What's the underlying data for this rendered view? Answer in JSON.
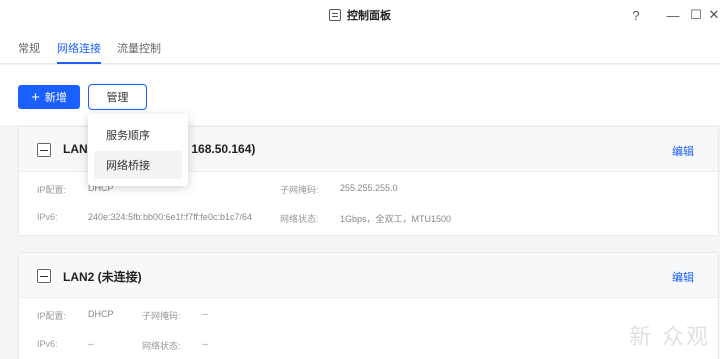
{
  "window": {
    "title": "控制面板",
    "help": "?",
    "minimize": "—",
    "maximize": "☐",
    "close": "✕"
  },
  "tabs": [
    {
      "label": "常规"
    },
    {
      "label": "网络连接"
    },
    {
      "label": "流量控制"
    }
  ],
  "toolbar": {
    "new_label": "新增",
    "manage_label": "管理"
  },
  "dropdown": {
    "items": [
      {
        "label": "服务顺序"
      },
      {
        "label": "网络桥接"
      }
    ]
  },
  "cards": [
    {
      "title_visible": "LAN1",
      "title_tail": "168.50.164)",
      "edit": "编辑",
      "ip_label": "IP配置:",
      "ip_value": "DHCP",
      "mask_label": "子网掩码:",
      "mask_value": "255.255.255.0",
      "ipv6_label": "IPv6:",
      "ipv6_value": "240e:324:5fb:bb00:6e1f:f7ff:fe0c:b1c7/64",
      "status_label": "网络状态:",
      "status_value": "1Gbps，全双工，MTU1500"
    },
    {
      "title": "LAN2 (未连接)",
      "edit": "编辑",
      "ip_label": "IP配置:",
      "ip_value": "DHCP",
      "mask_label": "子网掩码:",
      "mask_value": "--",
      "ipv6_label": "IPv6:",
      "ipv6_value": "--",
      "status_label": "网络状态:",
      "status_value": "--"
    }
  ],
  "watermark": "新 众观"
}
